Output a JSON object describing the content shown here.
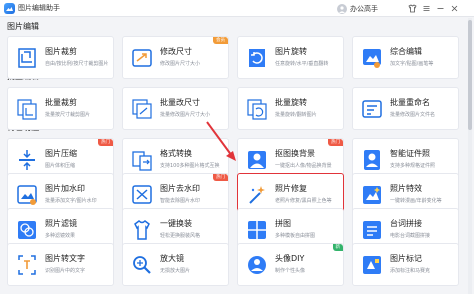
{
  "app": {
    "title": "图片编辑助手"
  },
  "account": {
    "name": "办公高手"
  },
  "sections": [
    {
      "title": "图片编辑",
      "cards": [
        {
          "name": "图片裁剪",
          "desc": "自由/按比例/按尺寸裁剪图片",
          "icon": "crop-icon"
        },
        {
          "name": "修改尺寸",
          "desc": "修改图片尺寸大小",
          "icon": "resize-icon",
          "badge": "会员"
        },
        {
          "name": "图片旋转",
          "desc": "任意旋转/水平/垂直翻转",
          "icon": "rotate-icon"
        },
        {
          "name": "综合编辑",
          "desc": "加文字/贴图/画笔等",
          "icon": "edit-icon"
        }
      ]
    },
    {
      "title": "批量编辑",
      "cards": [
        {
          "name": "批量裁剪",
          "desc": "批量按尺寸裁剪图片",
          "icon": "batch-crop-icon"
        },
        {
          "name": "批量改尺寸",
          "desc": "批量修改图片尺寸大小",
          "icon": "batch-resize-icon"
        },
        {
          "name": "批量旋转",
          "desc": "批量旋转/翻转图片",
          "icon": "batch-rotate-icon"
        },
        {
          "name": "批量重命名",
          "desc": "批量修改图片文件名",
          "icon": "rename-icon"
        }
      ]
    },
    {
      "title": "特色功能",
      "cards": [
        {
          "name": "图片压缩",
          "desc": "图片体积压缩",
          "icon": "compress-icon",
          "badge": "热门"
        },
        {
          "name": "格式转换",
          "desc": "支持100多种图片格式互换",
          "icon": "convert-icon"
        },
        {
          "name": "抠图换背景",
          "desc": "一键抠出人像/物品换背景",
          "icon": "cutout-icon",
          "badge": "热门"
        },
        {
          "name": "智能证件照",
          "desc": "支持多种规格证件照",
          "icon": "idphoto-icon"
        },
        {
          "name": "图片加水印",
          "desc": "批量添加文字/图片水印",
          "icon": "watermark-icon"
        },
        {
          "name": "图片去水印",
          "desc": "智能去除图片水印",
          "icon": "remove-watermark-icon",
          "badge": "热门"
        },
        {
          "name": "照片修复",
          "desc": "老照片修复/黑白照上色等",
          "icon": "repair-icon"
        },
        {
          "name": "照片特效",
          "desc": "一键转漫画/年龄变化等",
          "icon": "effect-icon"
        },
        {
          "name": "照片滤镜",
          "desc": "多种滤镜效果",
          "icon": "filter-icon"
        },
        {
          "name": "一键换装",
          "desc": "轻松更换服装风格",
          "icon": "outfit-icon"
        },
        {
          "name": "拼图",
          "desc": "多种模板自由拼图",
          "icon": "collage-icon"
        },
        {
          "name": "台词拼接",
          "desc": "电影台词截图拼接",
          "icon": "subtitle-icon"
        },
        {
          "name": "图片转文字",
          "desc": "识别图片中的文字",
          "icon": "ocr-icon"
        },
        {
          "name": "放大镜",
          "desc": "无损放大图片",
          "icon": "magnifier-icon"
        },
        {
          "name": "头像DIY",
          "desc": "制作个性头像",
          "icon": "avatar-diy-icon",
          "badge": "新"
        },
        {
          "name": "图片标记",
          "desc": "添加标注和马赛克",
          "icon": "mark-icon"
        }
      ]
    }
  ],
  "colors": {
    "accent": "#2f7cf6",
    "highlight": "#e1343a",
    "arrow": "#e1343a"
  }
}
